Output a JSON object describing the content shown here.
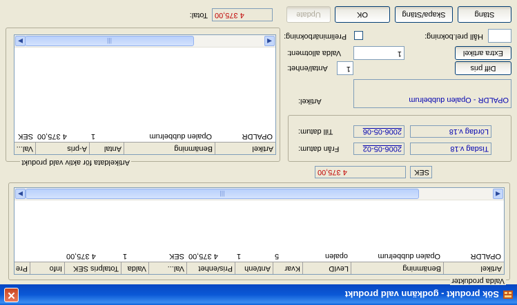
{
  "window": {
    "title": "Sök produkt - godkänn vald produkt",
    "close_glyph": "✕"
  },
  "top_bar": {
    "total_label": "Total:",
    "total_value": "4 375,00",
    "buttons": {
      "update": "Update",
      "ok": "OK",
      "create_close": "Skapa/Stäng",
      "close": "Stäng"
    }
  },
  "article_details": {
    "group_label": "Artikeldata för aktiv vald produkt",
    "columns": [
      "Artikel",
      "Benämning",
      "Antal",
      "A-pris",
      "Val..."
    ],
    "rows": [
      {
        "artikel": "OPALDR",
        "benamning": "Opalen dubbelrum",
        "antal": "1",
        "apris": "4 375,00",
        "val": "SEK"
      }
    ]
  },
  "options": {
    "preliminary_label": "Preliminärbokning:",
    "hold_label": "Håll prel.bokning:",
    "hold_value": "",
    "allotment_label": "Valda allotment:",
    "allotment_value": "1",
    "units_label": "Antal/enhet:",
    "units_value": "1",
    "extra_button": "Extra artikel",
    "diff_button": "Diff pris",
    "article_label": "Artikel:",
    "article_value": "OPALDR - Opalen dubbelrum"
  },
  "dates": {
    "from_label": "Från datum:",
    "from_date": "2006-05-02",
    "from_day": "Tisdag v.18",
    "to_label": "Till datum:",
    "to_date": "2006-05-06",
    "to_day": "Lördag v.18"
  },
  "price": {
    "amount": "4 375,00",
    "currency": "SEK"
  },
  "selected_products": {
    "group_label": "Valda produkter",
    "columns": [
      "Artikel",
      "Benämning",
      "LevID",
      "Kvar",
      "Ant/enh",
      "Pris/enhet",
      "Val...",
      "Valda",
      "Totalpris SEK",
      "Info",
      "Pre"
    ],
    "rows": [
      {
        "artikel": "OPALDR",
        "benamning": "Opalen dubbelrum",
        "levid": "opalen",
        "kvar": "5",
        "antenh": "1",
        "pris": "4 375,00",
        "val": "SEK",
        "valda": "1",
        "total": "4 375,00",
        "info": "",
        "pre": ""
      }
    ]
  },
  "scrollbar": {
    "left_arrow": "◀",
    "right_arrow": "▶",
    "thumb_grip": "|||"
  }
}
